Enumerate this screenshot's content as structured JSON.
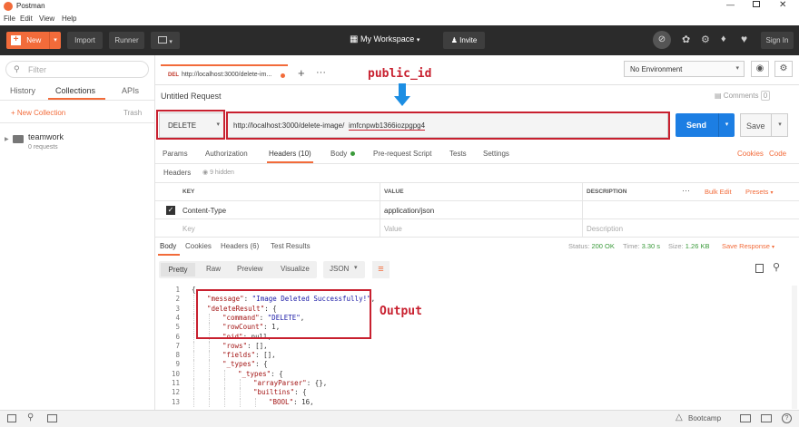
{
  "app": {
    "title": "Postman"
  },
  "menu": [
    "File",
    "Edit",
    "View",
    "Help"
  ],
  "header": {
    "new_label": "New",
    "import_label": "Import",
    "runner_label": "Runner",
    "workspace_label": "My Workspace",
    "invite_label": "Invite",
    "signin_label": "Sign In"
  },
  "sidebar": {
    "filter_placeholder": "Filter",
    "tabs": [
      "History",
      "Collections",
      "APIs"
    ],
    "new_collection": "+ New Collection",
    "trash": "Trash",
    "collection_name": "teamwork",
    "collection_count": "0 requests"
  },
  "request_tab": {
    "method": "DEL",
    "url": "http://localhost:3000/delete-im..."
  },
  "environment": "No Environment",
  "request": {
    "name": "Untitled Request",
    "comments_label": "Comments",
    "comments_count": "0",
    "method": "DELETE",
    "url_prefix": "http://localhost:3000/delete-image/",
    "url_id": "imfcnpwb1366iozpgpg4",
    "send_label": "Send",
    "save_label": "Save"
  },
  "req_tabs": {
    "params": "Params",
    "authorization": "Authorization",
    "headers": "Headers (10)",
    "body": "Body",
    "prerequest": "Pre-request Script",
    "tests": "Tests",
    "settings": "Settings",
    "cookies": "Cookies",
    "code": "Code"
  },
  "headers_bar": {
    "label": "Headers",
    "hidden": "9 hidden"
  },
  "headers_table": {
    "columns": [
      "KEY",
      "VALUE",
      "DESCRIPTION"
    ],
    "bulk_edit": "Bulk Edit",
    "presets": "Presets",
    "rows": [
      {
        "key": "Content-Type",
        "value": "application/json",
        "description": ""
      }
    ],
    "placeholder": {
      "key": "Key",
      "value": "Value",
      "description": "Description"
    }
  },
  "response_tabs": {
    "body": "Body",
    "cookies": "Cookies",
    "headers": "Headers (6)",
    "test_results": "Test Results",
    "status_label": "Status:",
    "status_value": "200 OK",
    "time_label": "Time:",
    "time_value": "3.30 s",
    "size_label": "Size:",
    "size_value": "1.26 KB",
    "save_response": "Save Response"
  },
  "view_modes": [
    "Pretty",
    "Raw",
    "Preview",
    "Visualize"
  ],
  "format": "JSON",
  "code_lines": [
    {
      "n": "1",
      "indent": 0,
      "parts": [
        [
          "p",
          "{"
        ]
      ]
    },
    {
      "n": "2",
      "indent": 1,
      "parts": [
        [
          "k",
          "\"message\""
        ],
        [
          "p",
          ": "
        ],
        [
          "s",
          "\"Image Deleted Successfully!\""
        ],
        [
          "p",
          ","
        ]
      ]
    },
    {
      "n": "3",
      "indent": 1,
      "parts": [
        [
          "k",
          "\"deleteResult\""
        ],
        [
          "p",
          ": {"
        ]
      ]
    },
    {
      "n": "4",
      "indent": 2,
      "parts": [
        [
          "k",
          "\"command\""
        ],
        [
          "p",
          ": "
        ],
        [
          "s",
          "\"DELETE\""
        ],
        [
          "p",
          ","
        ]
      ]
    },
    {
      "n": "5",
      "indent": 2,
      "parts": [
        [
          "k",
          "\"rowCount\""
        ],
        [
          "p",
          ": 1,"
        ]
      ]
    },
    {
      "n": "6",
      "indent": 2,
      "parts": [
        [
          "k",
          "\"oid\""
        ],
        [
          "p",
          ": null,"
        ]
      ]
    },
    {
      "n": "7",
      "indent": 2,
      "parts": [
        [
          "k",
          "\"rows\""
        ],
        [
          "p",
          ": [],"
        ]
      ]
    },
    {
      "n": "8",
      "indent": 2,
      "parts": [
        [
          "k",
          "\"fields\""
        ],
        [
          "p",
          ": [],"
        ]
      ]
    },
    {
      "n": "9",
      "indent": 2,
      "parts": [
        [
          "k",
          "\"_types\""
        ],
        [
          "p",
          ": {"
        ]
      ]
    },
    {
      "n": "10",
      "indent": 3,
      "parts": [
        [
          "k",
          "\"_types\""
        ],
        [
          "p",
          ": {"
        ]
      ]
    },
    {
      "n": "11",
      "indent": 4,
      "parts": [
        [
          "k",
          "\"arrayParser\""
        ],
        [
          "p",
          ": {},"
        ]
      ]
    },
    {
      "n": "12",
      "indent": 4,
      "parts": [
        [
          "k",
          "\"builtins\""
        ],
        [
          "p",
          ": {"
        ]
      ]
    },
    {
      "n": "13",
      "indent": 5,
      "parts": [
        [
          "k",
          "\"BOOL\""
        ],
        [
          "p",
          ": 16,"
        ]
      ]
    }
  ],
  "annotations": {
    "public_id": "public_id",
    "output": "Output"
  },
  "footer": {
    "bootcamp": "Bootcamp"
  }
}
